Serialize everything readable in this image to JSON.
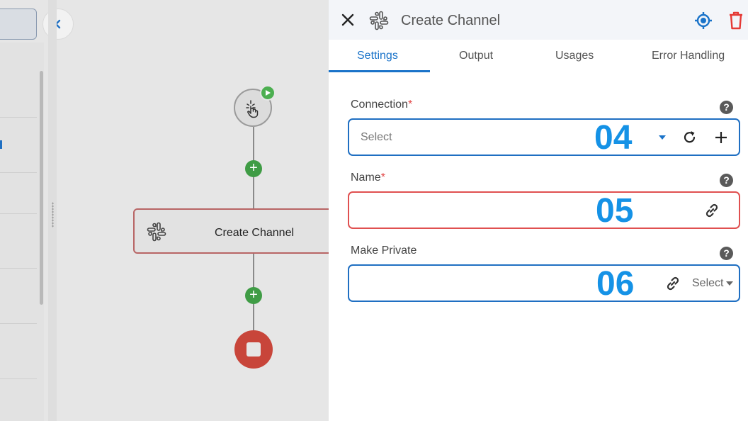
{
  "canvas": {
    "step_label": "Create Channel"
  },
  "panel": {
    "title": "Create Channel",
    "tabs": [
      {
        "label": "Settings",
        "active": true
      },
      {
        "label": "Output",
        "active": false
      },
      {
        "label": "Usages",
        "active": false
      },
      {
        "label": "Error Handling",
        "active": false
      }
    ],
    "fields": {
      "connection": {
        "label": "Connection",
        "required": "*",
        "placeholder": "Select",
        "annotation": "04"
      },
      "name": {
        "label": "Name",
        "required": "*",
        "value": "",
        "annotation": "05"
      },
      "make_private": {
        "label": "Make Private",
        "select_label": "Select",
        "annotation": "06"
      }
    },
    "help_glyph": "?"
  },
  "colors": {
    "accent": "#1a73c9",
    "error_border": "#e05050",
    "annotation": "#1592e6",
    "delete": "#e53935",
    "node_green": "#3f9c45",
    "stop_red": "#c8453a"
  },
  "icons": {
    "close": "close-icon",
    "slack": "slack-icon",
    "target": "target-icon",
    "delete": "trash-icon",
    "refresh": "refresh-icon",
    "add": "plus-icon",
    "link": "link-icon",
    "dropdown": "caret-down-icon"
  }
}
